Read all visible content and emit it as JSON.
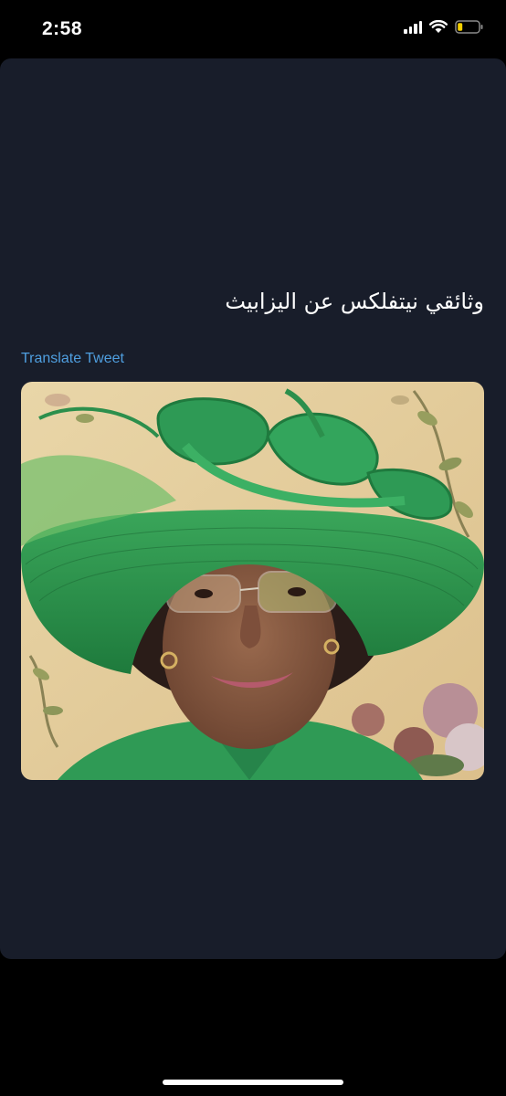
{
  "status_bar": {
    "time": "2:58",
    "icons": [
      "cellular-signal-icon",
      "wifi-icon",
      "battery-low-icon"
    ],
    "battery_color": "#f5d000"
  },
  "tweet": {
    "text": "وثائقي نيتفلكس عن اليزابيث",
    "translate_label": "Translate Tweet",
    "link_color": "#4f9fe0",
    "media": {
      "type": "photo",
      "subject": "elderly woman wearing a large green hat and glasses"
    }
  },
  "colors": {
    "card_background": "#181d2a",
    "screen_background": "#000000"
  }
}
